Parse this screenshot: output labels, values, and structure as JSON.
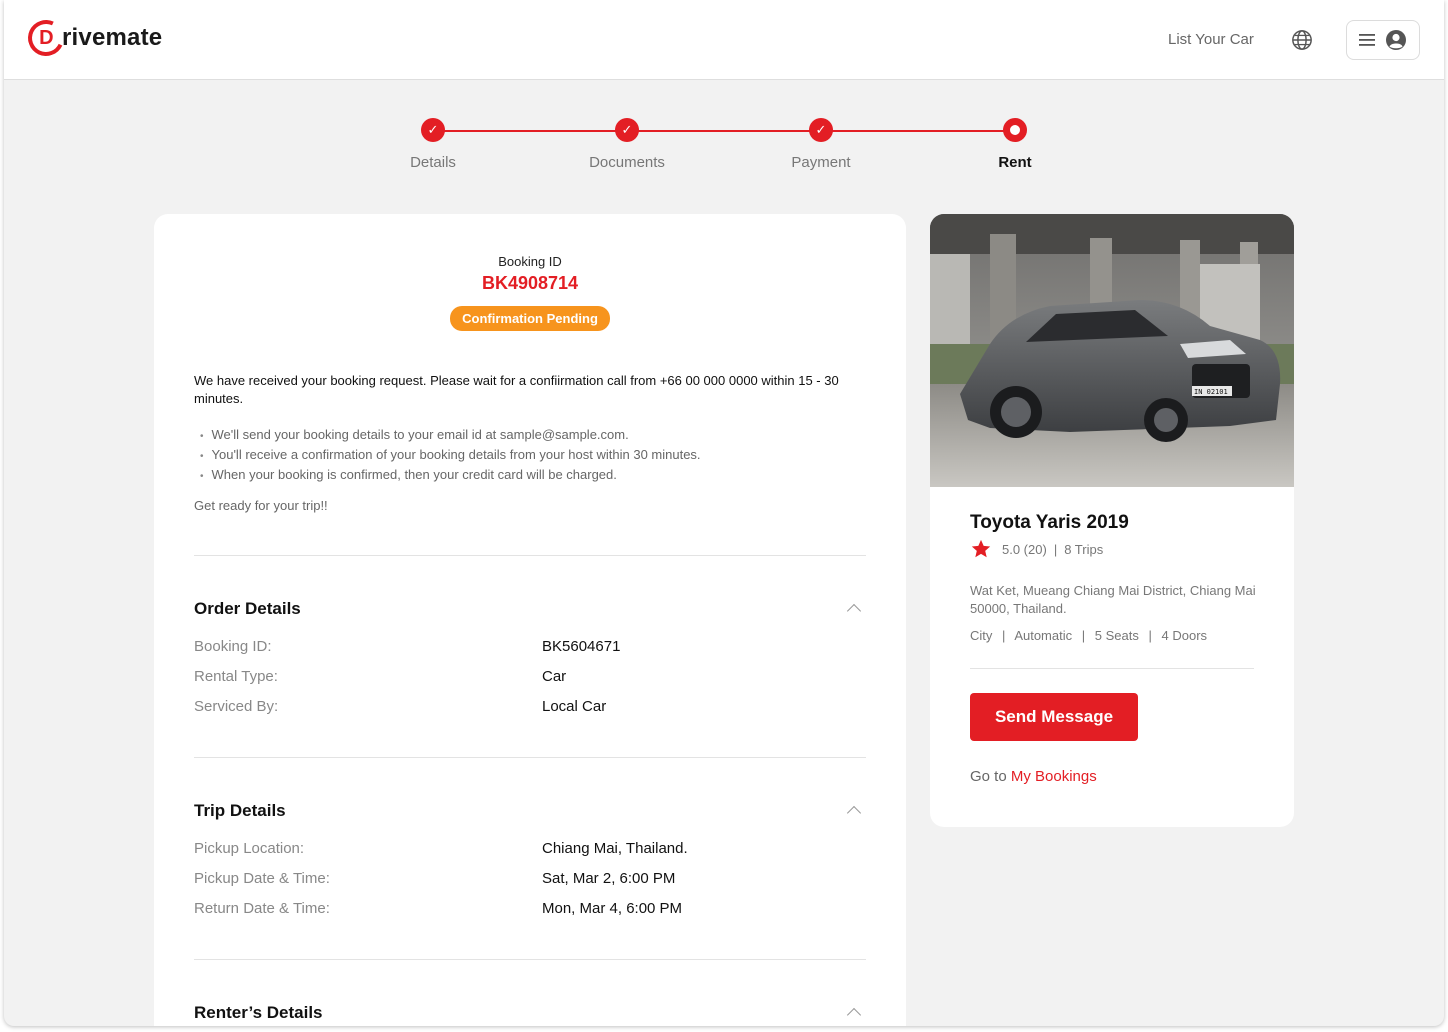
{
  "brand": {
    "initial": "D",
    "name": "rivemate",
    "accent": "#e31e24"
  },
  "header": {
    "list_car": "List Your Car"
  },
  "stepper": {
    "steps": [
      {
        "label": "Details",
        "state": "done"
      },
      {
        "label": "Documents",
        "state": "done"
      },
      {
        "label": "Payment",
        "state": "done"
      },
      {
        "label": "Rent",
        "state": "current"
      }
    ]
  },
  "booking": {
    "id_label": "Booking ID",
    "id": "BK4908714",
    "status": "Confirmation Pending",
    "status_color": "#f7941d",
    "message": "We have received your booking request. Please wait for a confiirmation call from +66 00 000 0000 within 15 - 30 minutes.",
    "bullets": [
      "We'll send your booking details to your email id at sample@sample.com.",
      "You'll receive a confirmation of your booking details from your host within 30 minutes.",
      "When your booking is confirmed, then your credit card will be charged."
    ],
    "ready": "Get ready for your trip!!"
  },
  "order": {
    "title": "Order Details",
    "rows": [
      {
        "k": "Booking ID:",
        "v": "BK5604671"
      },
      {
        "k": "Rental Type:",
        "v": "Car"
      },
      {
        "k": "Serviced By:",
        "v": "Local Car"
      }
    ]
  },
  "trip": {
    "title": "Trip Details",
    "rows": [
      {
        "k": "Pickup Location:",
        "v": "Chiang Mai, Thailand."
      },
      {
        "k": "Pickup Date & Time:",
        "v": "Sat, Mar 2, 6:00 PM"
      },
      {
        "k": "Return Date & Time:",
        "v": "Mon, Mar 4, 6:00 PM"
      }
    ]
  },
  "renter": {
    "title": "Renter’s Details"
  },
  "car": {
    "name": "Toyota Yaris 2019",
    "rating": "5.0 (20)",
    "trips": "8 Trips",
    "address": "Wat Ket, Mueang Chiang Mai District, Chiang Mai 50000, Thailand.",
    "features": [
      "City",
      "Automatic",
      "5 Seats",
      "4 Doors"
    ],
    "plate": "IN 02101",
    "send_message": "Send Message",
    "goto_prefix": "Go to",
    "goto_link": "My Bookings"
  }
}
